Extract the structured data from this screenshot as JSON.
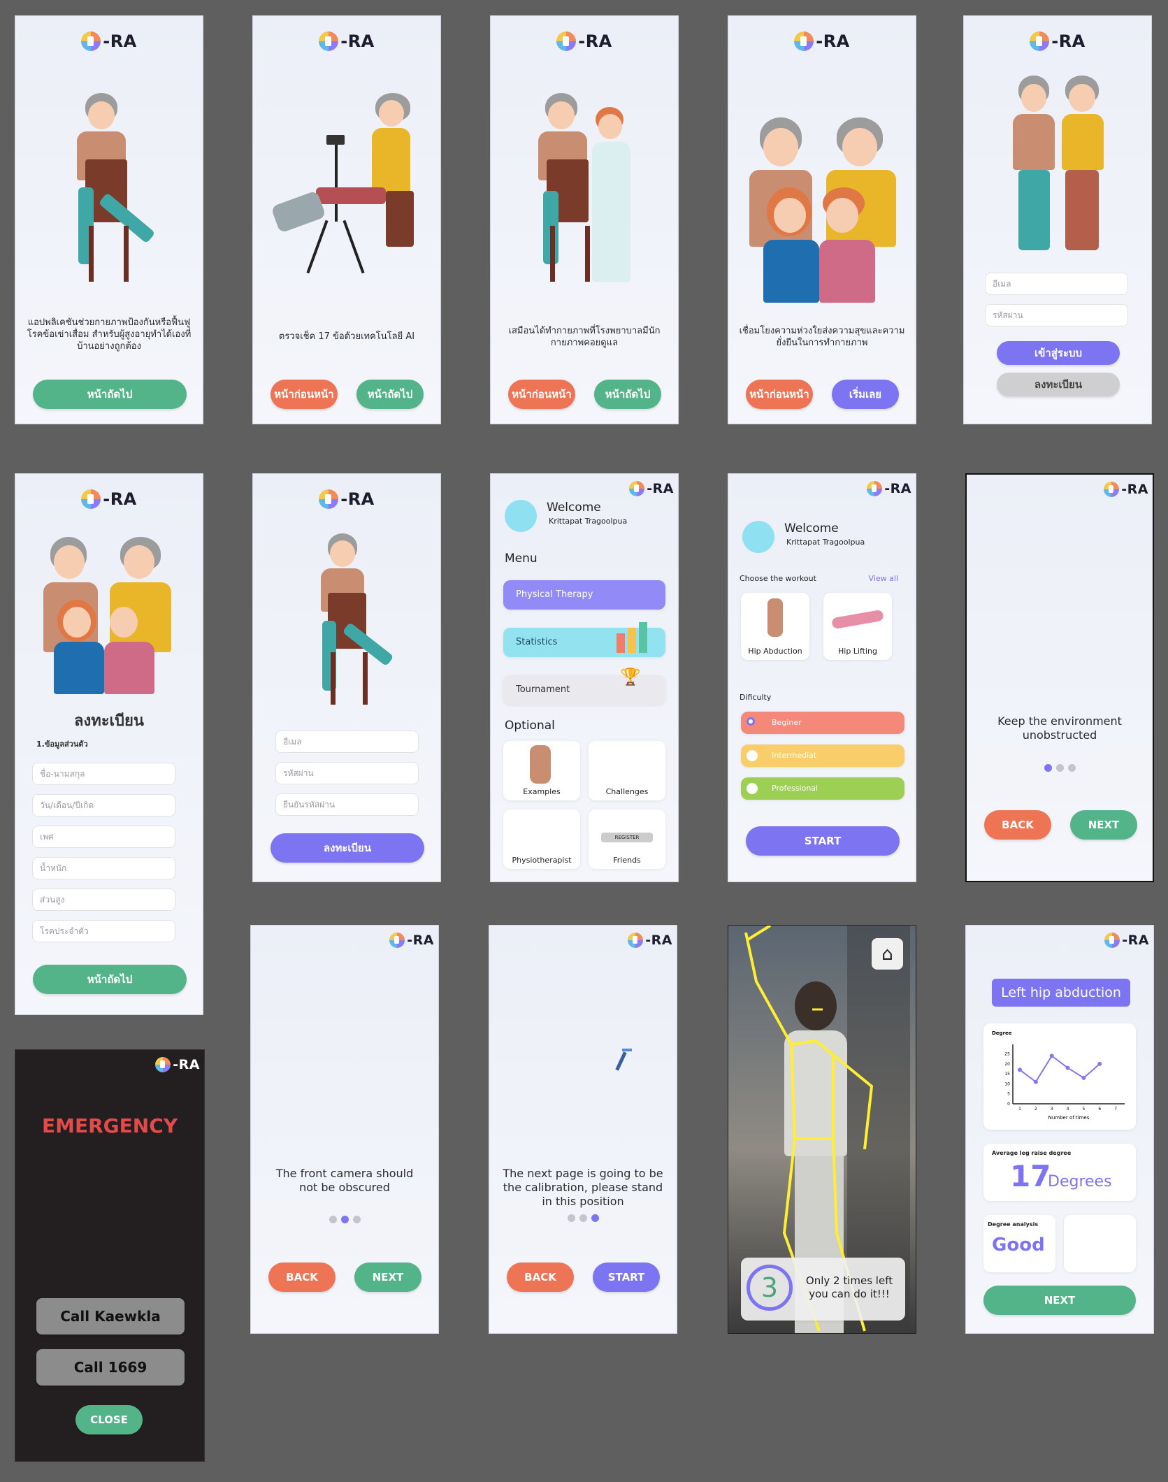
{
  "app_name": "-RA",
  "onboarding": [
    {
      "caption": "แอปพลิเคชันช่วยกายภาพป้องกันหรือฟื้นฟูโรคข้อเข่าเสื่อม สำหรับผู้สูงอายุทำได้เองที่บ้านอย่างถูกต้อง",
      "next": "หน้าถัดไป"
    },
    {
      "caption": "ตรวจเช็ค 17 ข้อด้วยเทคโนโลยี AI",
      "prev": "หน้าก่อนหน้า",
      "next": "หน้าถัดไป"
    },
    {
      "caption": "เสมือนได้ทำกายภาพที่โรงพยาบาลมีนักกายภาพคอยดูแล",
      "prev": "หน้าก่อนหน้า",
      "next": "หน้าถัดไป"
    },
    {
      "caption": "เชื่อมโยงความห่วงใยส่งความสุขและความยั่งยืนในการทำกายภาพ",
      "prev": "หน้าก่อนหน้า",
      "next": "เริ่มเลย"
    }
  ],
  "login": {
    "email_placeholder": "อีเมล",
    "password_placeholder": "รหัสผ่าน",
    "login": "เข้าสู่ระบบ",
    "register": "ลงทะเบียน"
  },
  "register_profile": {
    "title": "ลงทะเบียน",
    "section": "1.ข้อมูลส่วนตัว",
    "fields": [
      "ชื่อ-นามสกุล",
      "วัน/เดือน/ปีเกิด",
      "เพศ",
      "น้ำหนัก",
      "ส่วนสูง",
      "โรคประจำตัว"
    ],
    "next": "หน้าถัดไป"
  },
  "register_account": {
    "fields": [
      "อีเมล",
      "รหัสผ่าน",
      "ยืนยันรหัสผ่าน"
    ],
    "submit": "ลงทะเบียน"
  },
  "menu": {
    "welcome": "Welcome",
    "user": "Krittapat Tragoolpua",
    "menu_title": "Menu",
    "items": [
      "Physical Therapy",
      "Statistics",
      "Tournament"
    ],
    "optional_title": "Optional",
    "optional": [
      "Examples",
      "Challenges",
      "Physiotherapist",
      "Friends"
    ],
    "register_tag": "REGISTER"
  },
  "workout": {
    "welcome": "Welcome",
    "user": "Krittapat Tragoolpua",
    "choose": "Choose the workout",
    "view_all": "View all",
    "workouts": [
      "Hip Abduction",
      "Hip Lifting"
    ],
    "difficulty_title": "Dificulty",
    "levels": [
      "Beginer",
      "Intermediat",
      "Professional"
    ],
    "start": "START"
  },
  "tip_environment": {
    "text": "Keep the environment unobstructed",
    "back": "BACK",
    "next": "NEXT"
  },
  "tip_camera": {
    "text": "The front camera should not be obscured",
    "back": "BACK",
    "next": "NEXT"
  },
  "tip_calibration": {
    "text": "The next page is going to be the calibration, please stand in this position",
    "back": "BACK",
    "start": "START"
  },
  "camera": {
    "count": "3",
    "message": "Only 2 times left you can do it!!!"
  },
  "result": {
    "title": "Left hip abduction",
    "chart_title": "Degree",
    "avg_label": "Average leg raise degree",
    "avg_value": "17",
    "avg_unit": "Degrees",
    "analysis_label": "Degree analysis",
    "analysis_value": "Good",
    "next": "NEXT"
  },
  "chart_data": {
    "type": "line",
    "x": [
      1,
      2,
      3,
      4,
      5,
      6,
      7
    ],
    "values": [
      17,
      11,
      24,
      18,
      13,
      20
    ],
    "title": "Degree",
    "xlabel": "Number of times",
    "ylabel": "Degree",
    "y_ticks": [
      0,
      5,
      10,
      15,
      20,
      25
    ],
    "ylim": [
      0,
      28
    ]
  },
  "emergency": {
    "title": "EMERGENCY",
    "call1": "Call Kaewkla",
    "call2": "Call 1669",
    "close": "CLOSE"
  },
  "colors": {
    "green": "#52b488",
    "orange": "#ee7456",
    "purple": "#7d74f1",
    "red": "#e34a4a"
  }
}
